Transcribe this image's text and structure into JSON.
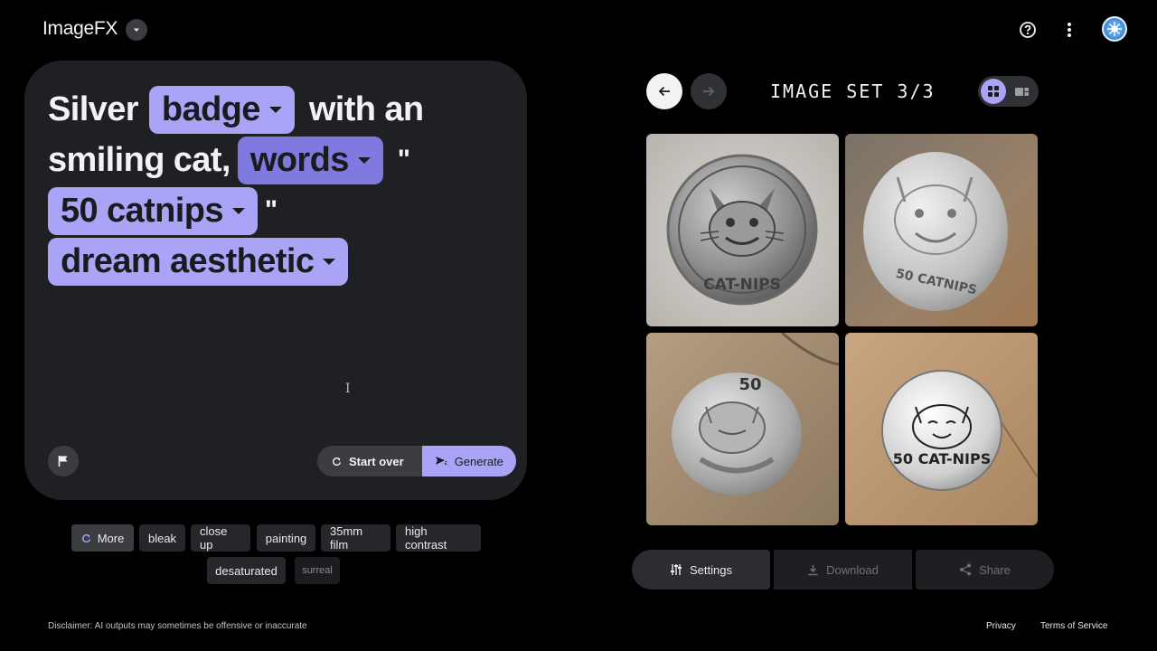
{
  "header": {
    "app_title": "ImageFX",
    "icons": [
      "chevron-down-icon",
      "help-icon",
      "more-vert-icon",
      "avatar"
    ]
  },
  "prompt": {
    "line1": {
      "text_before": "Silver",
      "chip": "badge",
      "text_after": "with an"
    },
    "line2": {
      "text_before": "smiling cat,",
      "chip": "words",
      "text_after": "\""
    },
    "line3": {
      "chip": "50 catnips",
      "text_after": "\""
    },
    "line4": {
      "chip": "dream aesthetic"
    }
  },
  "buttons": {
    "start_over": "Start over",
    "generate": "Generate"
  },
  "suggestions": {
    "more": "More",
    "chips": [
      "bleak",
      "close up",
      "painting",
      "35mm film",
      "high contrast",
      "desaturated",
      "surreal"
    ]
  },
  "image_panel": {
    "title": "IMAGE SET 3/3",
    "images": [
      {
        "name": "cat-nips-badge-1",
        "label": "CAT-NIPS"
      },
      {
        "name": "50-catnips-badge-2",
        "label": "50 CATNIPS"
      },
      {
        "name": "50-cat-badge-3",
        "label": "50"
      },
      {
        "name": "50-cat-nips-badge-4",
        "label": "50 CAT-NIPS"
      }
    ]
  },
  "actions": {
    "settings": "Settings",
    "download": "Download",
    "share": "Share"
  },
  "footer": {
    "disclaimer": "Disclaimer: AI outputs may sometimes be offensive or inaccurate",
    "privacy": "Privacy",
    "terms": "Terms of Service"
  },
  "colors": {
    "background": "#000000",
    "card": "#1f2023",
    "chip_accent": "#a9a4f5",
    "chip_accent_dark": "#7f79e0"
  }
}
